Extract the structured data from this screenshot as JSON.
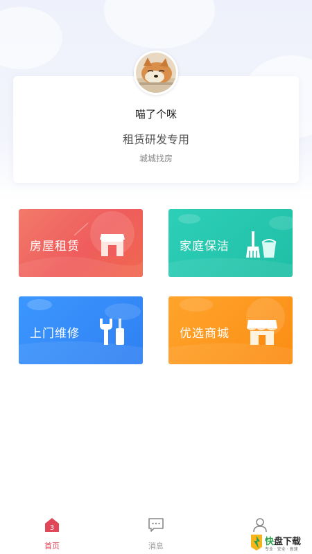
{
  "profile": {
    "name": "喵了个咪",
    "role": "租赁研发专用",
    "company": "城城找房",
    "avatar_icon": "dog-avatar-photo"
  },
  "services": [
    {
      "label": "房屋租赁",
      "icon": "house-icon",
      "color": "#ef5d5d"
    },
    {
      "label": "家庭保洁",
      "icon": "broom-bucket-icon",
      "color": "#1fbfa6"
    },
    {
      "label": "上门维修",
      "icon": "wrench-screwdriver-icon",
      "color": "#2f80f2"
    },
    {
      "label": "优选商城",
      "icon": "shop-icon",
      "color": "#fb8d14"
    }
  ],
  "tabbar": {
    "items": [
      {
        "label": "首页",
        "icon": "home-icon",
        "active": true
      },
      {
        "label": "消息",
        "icon": "message-icon",
        "active": false
      },
      {
        "label": "",
        "icon": "person-icon",
        "active": false
      }
    ],
    "active_color": "#e0485a",
    "inactive_color": "#999999"
  },
  "watermark": {
    "brand": "快",
    "text": "盘下载",
    "tagline": "专业 · 安全 · 高速"
  }
}
